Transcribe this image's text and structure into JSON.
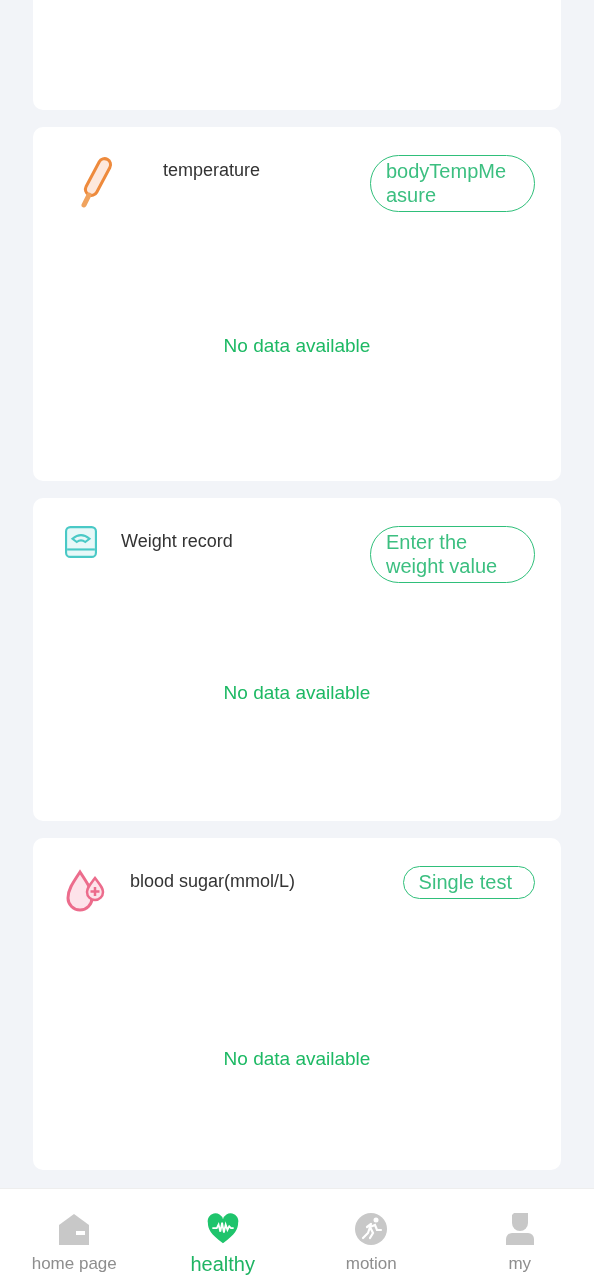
{
  "cards": [
    {
      "kind": "blank"
    },
    {
      "kind": "thermometer",
      "title": "temperature",
      "action": "bodyTempMeasure",
      "empty_text": "No data available"
    },
    {
      "kind": "scale",
      "title": "Weight record",
      "action": "Enter the weight value",
      "empty_text": "No data available"
    },
    {
      "kind": "blood-drop",
      "title": "blood sugar(mmol/L)",
      "action": "Single test",
      "empty_text": "No data available"
    }
  ],
  "tabs": [
    {
      "kind": "home",
      "label": "home page",
      "selected": false
    },
    {
      "kind": "heart",
      "label": "healthy",
      "selected": true
    },
    {
      "kind": "run",
      "label": "motion",
      "selected": false
    },
    {
      "kind": "person",
      "label": "my",
      "selected": false
    }
  ]
}
